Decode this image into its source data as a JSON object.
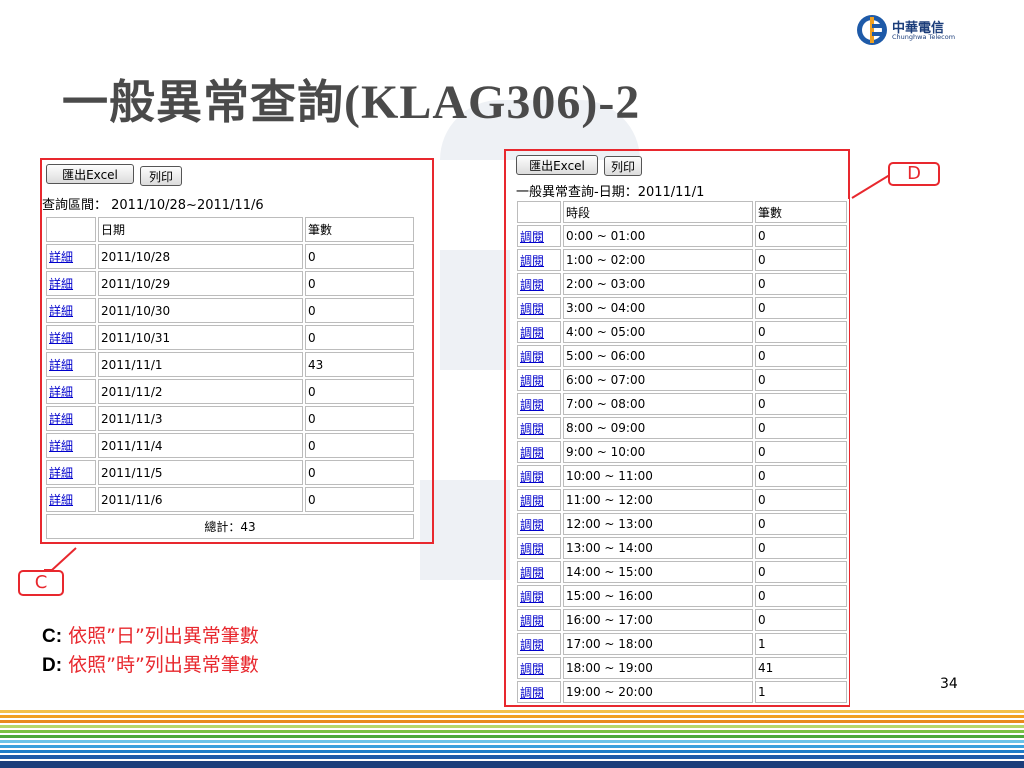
{
  "logo": {
    "name": "中華電信",
    "sub": "Chunghwa Telecom"
  },
  "title": {
    "main": "一般異常查詢",
    "code": "(KLAG306)-2"
  },
  "panel_c": {
    "export_label": "匯出Excel",
    "print_label": "列印",
    "range_text": "查詢區間： 2011/10/28~2011/11/6",
    "headers": [
      "",
      "日期",
      "筆數"
    ],
    "rows": [
      {
        "link": "詳細",
        "date": "2011/10/28",
        "count": "0"
      },
      {
        "link": "詳細",
        "date": "2011/10/29",
        "count": "0"
      },
      {
        "link": "詳細",
        "date": "2011/10/30",
        "count": "0"
      },
      {
        "link": "詳細",
        "date": "2011/10/31",
        "count": "0"
      },
      {
        "link": "詳細",
        "date": "2011/11/1",
        "count": "43"
      },
      {
        "link": "詳細",
        "date": "2011/11/2",
        "count": "0"
      },
      {
        "link": "詳細",
        "date": "2011/11/3",
        "count": "0"
      },
      {
        "link": "詳細",
        "date": "2011/11/4",
        "count": "0"
      },
      {
        "link": "詳細",
        "date": "2011/11/5",
        "count": "0"
      },
      {
        "link": "詳細",
        "date": "2011/11/6",
        "count": "0"
      }
    ],
    "total": "總計：43"
  },
  "panel_d": {
    "export_label": "匯出Excel",
    "print_label": "列印",
    "title_text": "一般異常查詢-日期：2011/11/1",
    "headers": [
      "",
      "時段",
      "筆數"
    ],
    "rows": [
      {
        "link": "調閱",
        "period": "0:00 ~ 01:00",
        "count": "0"
      },
      {
        "link": "調閱",
        "period": "1:00 ~ 02:00",
        "count": "0"
      },
      {
        "link": "調閱",
        "period": "2:00 ~ 03:00",
        "count": "0"
      },
      {
        "link": "調閱",
        "period": "3:00 ~ 04:00",
        "count": "0"
      },
      {
        "link": "調閱",
        "period": "4:00 ~ 05:00",
        "count": "0"
      },
      {
        "link": "調閱",
        "period": "5:00 ~ 06:00",
        "count": "0"
      },
      {
        "link": "調閱",
        "period": "6:00 ~ 07:00",
        "count": "0"
      },
      {
        "link": "調閱",
        "period": "7:00 ~ 08:00",
        "count": "0"
      },
      {
        "link": "調閱",
        "period": "8:00 ~ 09:00",
        "count": "0"
      },
      {
        "link": "調閱",
        "period": "9:00 ~ 10:00",
        "count": "0"
      },
      {
        "link": "調閱",
        "period": "10:00 ~ 11:00",
        "count": "0"
      },
      {
        "link": "調閱",
        "period": "11:00 ~ 12:00",
        "count": "0"
      },
      {
        "link": "調閱",
        "period": "12:00 ~ 13:00",
        "count": "0"
      },
      {
        "link": "調閱",
        "period": "13:00 ~ 14:00",
        "count": "0"
      },
      {
        "link": "調閱",
        "period": "14:00 ~ 15:00",
        "count": "0"
      },
      {
        "link": "調閱",
        "period": "15:00 ~ 16:00",
        "count": "0"
      },
      {
        "link": "調閱",
        "period": "16:00 ~ 17:00",
        "count": "0"
      },
      {
        "link": "調閱",
        "period": "17:00 ~ 18:00",
        "count": "1"
      },
      {
        "link": "調閱",
        "period": "18:00 ~ 19:00",
        "count": "41"
      },
      {
        "link": "調閱",
        "period": "19:00 ~ 20:00",
        "count": "1"
      }
    ]
  },
  "callouts": {
    "c": "C",
    "d": "D"
  },
  "notes": [
    {
      "key": "C:",
      "text": " 依照”日”列出異常筆數"
    },
    {
      "key": "D:",
      "text": " 依照”時”列出異常筆數"
    }
  ],
  "page_number": "34",
  "colors": {
    "accent_red": "#e8282e",
    "link_blue": "#0000cc",
    "title_gray": "#4a4a4a"
  }
}
